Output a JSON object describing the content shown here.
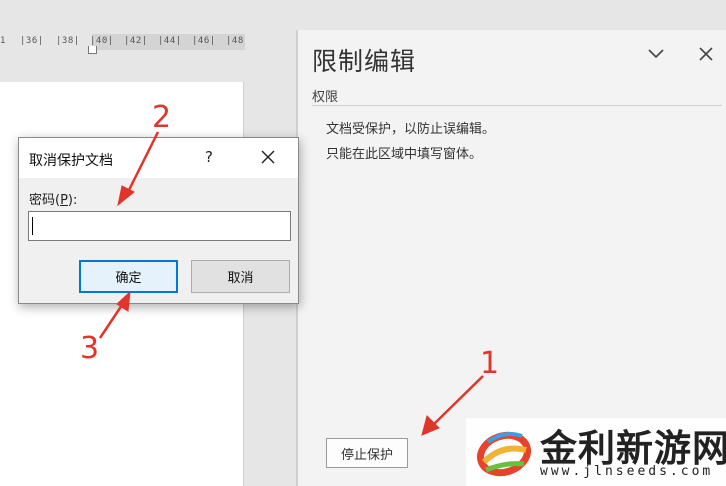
{
  "ruler": {
    "labels": [
      "1",
      "|36|",
      "|38|",
      "|40|",
      "|42|",
      "|44|",
      "|46|",
      "|48"
    ]
  },
  "pane": {
    "title": "限制编辑",
    "section": "权限",
    "info_line1": "文档受保护，以防止误编辑。",
    "info_line2": "只能在此区域中填写窗体。",
    "stop_button": "停止保护"
  },
  "dialog": {
    "title": "取消保护文档",
    "help": "?",
    "label_prefix": "密码(",
    "label_key": "P",
    "label_suffix": "):",
    "password_value": "",
    "ok": "确定",
    "cancel": "取消"
  },
  "annotations": {
    "step1": "1",
    "step2": "2",
    "step3": "3",
    "color": "#e0352a"
  },
  "watermark": {
    "name": "金利新游网",
    "url": "www.jlnseeds.com"
  },
  "colors": {
    "accent": "#0078d7",
    "pane_bg": "#f3f3f3",
    "dialog_bg": "#f0f0f0"
  }
}
